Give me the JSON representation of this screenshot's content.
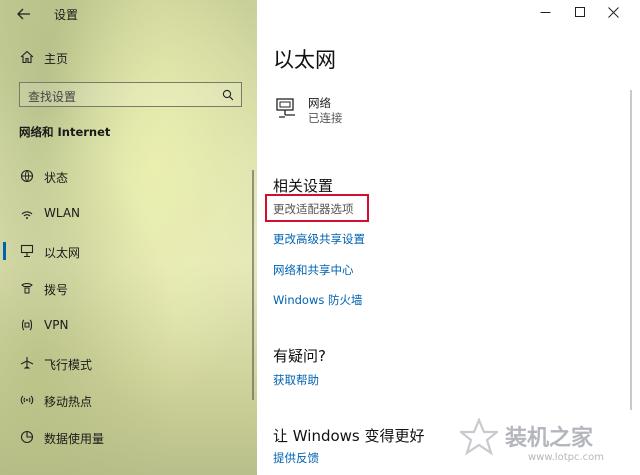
{
  "window": {
    "title": "设置",
    "back_icon": "back-arrow-icon",
    "controls": [
      "minimize-icon",
      "maximize-icon",
      "close-icon"
    ]
  },
  "sidebar": {
    "home_label": "主页",
    "search_placeholder": "查找设置",
    "section_title": "网络和 Internet",
    "items": [
      {
        "label": "状态",
        "icon": "status-icon"
      },
      {
        "label": "WLAN",
        "icon": "wifi-icon"
      },
      {
        "label": "以太网",
        "icon": "ethernet-icon",
        "selected": true
      },
      {
        "label": "拨号",
        "icon": "dialup-icon"
      },
      {
        "label": "VPN",
        "icon": "vpn-icon"
      },
      {
        "label": "飞行模式",
        "icon": "airplane-icon"
      },
      {
        "label": "移动热点",
        "icon": "hotspot-icon"
      },
      {
        "label": "数据使用量",
        "icon": "data-usage-icon"
      }
    ]
  },
  "main": {
    "page_title": "以太网",
    "network": {
      "name": "网络",
      "status": "已连接"
    },
    "related_title": "相关设置",
    "related_links": [
      "更改适配器选项",
      "更改高级共享设置",
      "网络和共享中心",
      "Windows 防火墙"
    ],
    "help_title": "有疑问?",
    "help_link": "获取帮助",
    "improve_title": "让 Windows 变得更好",
    "feedback_link": "提供反馈"
  },
  "watermark": {
    "brand": "装机之家",
    "url": "www.lotpc.com"
  },
  "colors": {
    "link": "#0063b1",
    "highlight_box": "#d2102e",
    "selected_bar": "#0063b1"
  }
}
